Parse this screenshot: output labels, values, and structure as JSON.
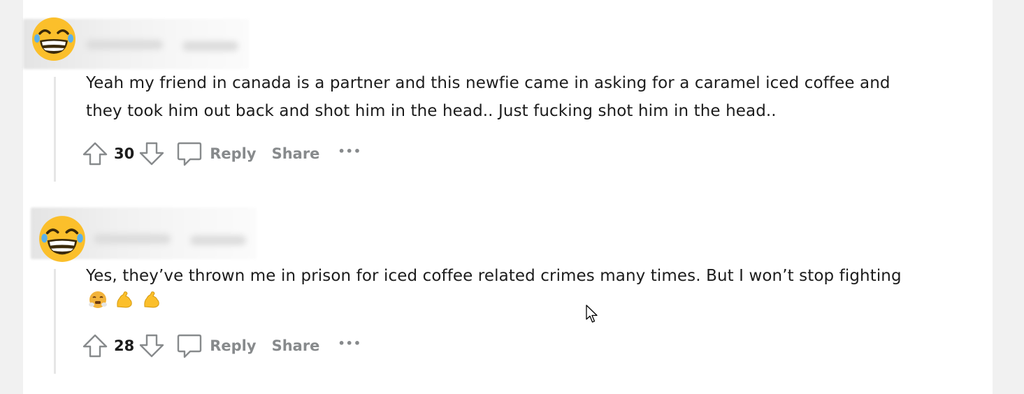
{
  "comments": [
    {
      "body": "Yeah my friend in canada is a partner and this newfie came in asking for a caramel iced coffee and they took him out back and shot him in the head.. Just fucking shot him in the head..",
      "votes": "30",
      "reply_label": "Reply",
      "share_label": "Share",
      "more_label": "•••",
      "avatar_icon": "laughing-emoji-icon"
    },
    {
      "body": "Yes, they’ve thrown me in prison for iced coffee related crimes many times. But I won’t stop fighting",
      "emojis": [
        "😤",
        "💪",
        "💪"
      ],
      "votes": "28",
      "reply_label": "Reply",
      "share_label": "Share",
      "more_label": "•••",
      "avatar_icon": "laughing-emoji-icon"
    }
  ],
  "colors": {
    "text": "#1c1c1c",
    "muted": "#878a8c",
    "thread_line": "#e6e6e6",
    "avatar_yellow": "#fbbf2b"
  }
}
